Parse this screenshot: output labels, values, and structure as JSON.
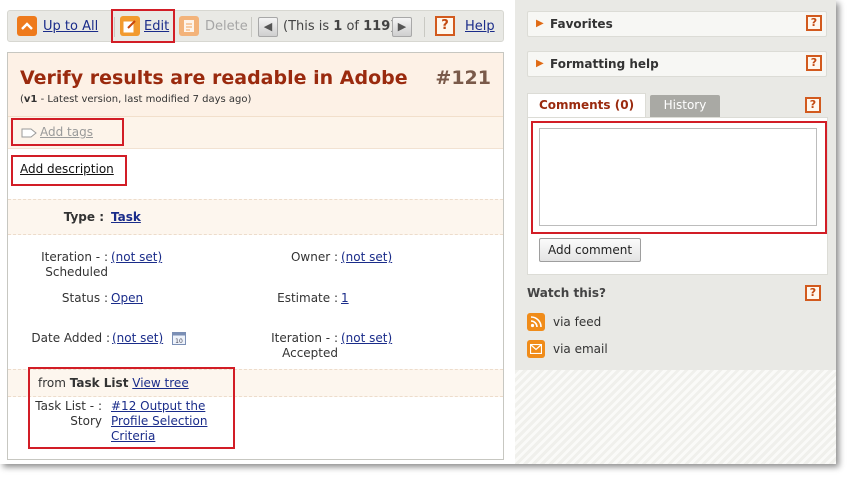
{
  "toolbar": {
    "up_label": "Up to All",
    "edit_label": "Edit",
    "delete_label": "Delete",
    "pager_prefix": "(This is ",
    "pager_current": "1",
    "pager_mid": " of ",
    "pager_total": "119",
    "pager_suffix": ")",
    "help_icon": "?",
    "help_label": "Help"
  },
  "item": {
    "title": "Verify results are readable in Adobe",
    "number": "#121",
    "version": "v1",
    "version_note": " - Latest version, last modified 7 days ago)",
    "version_open": "(",
    "add_tags": "Add tags",
    "add_description": "Add description"
  },
  "fields": {
    "type_label": "Type :",
    "type_value": "Task",
    "iter_sched_label_1": "Iteration - :",
    "iter_sched_label_2": "Scheduled",
    "iter_sched_value": "(not set)",
    "owner_label": "Owner :",
    "owner_value": "(not set)",
    "status_label": "Status :",
    "status_value": "Open",
    "estimate_label": "Estimate :",
    "estimate_value": "1",
    "date_added_label": "Date Added :",
    "date_added_value": "(not set)",
    "iter_acc_label_1": "Iteration - :",
    "iter_acc_label_2": "Accepted",
    "iter_acc_value": "(not set)"
  },
  "relations": {
    "from_prefix": "from ",
    "from_type": "Task List",
    "view_tree": "View tree",
    "story_label_1": "Task List - :",
    "story_label_2": "Story",
    "story_value_1": "#12 Output the",
    "story_value_2": "Profile Selection",
    "story_value_3": "Criteria"
  },
  "sidebar": {
    "favorites": "Favorites",
    "formatting_help": "Formatting help",
    "help_icon": "?",
    "tabs": [
      {
        "label": "Comments (0)",
        "active": true
      },
      {
        "label": "History",
        "active": false
      }
    ],
    "comment_value": "",
    "add_comment": "Add comment",
    "watch_title": "Watch this?",
    "via_feed": "via feed",
    "via_email": "via email"
  },
  "colors": {
    "accent_orange": "#e06a14",
    "title_red": "#9a2a0e",
    "link_blue": "#1a2c8a",
    "highlight_red": "#d21d26"
  }
}
